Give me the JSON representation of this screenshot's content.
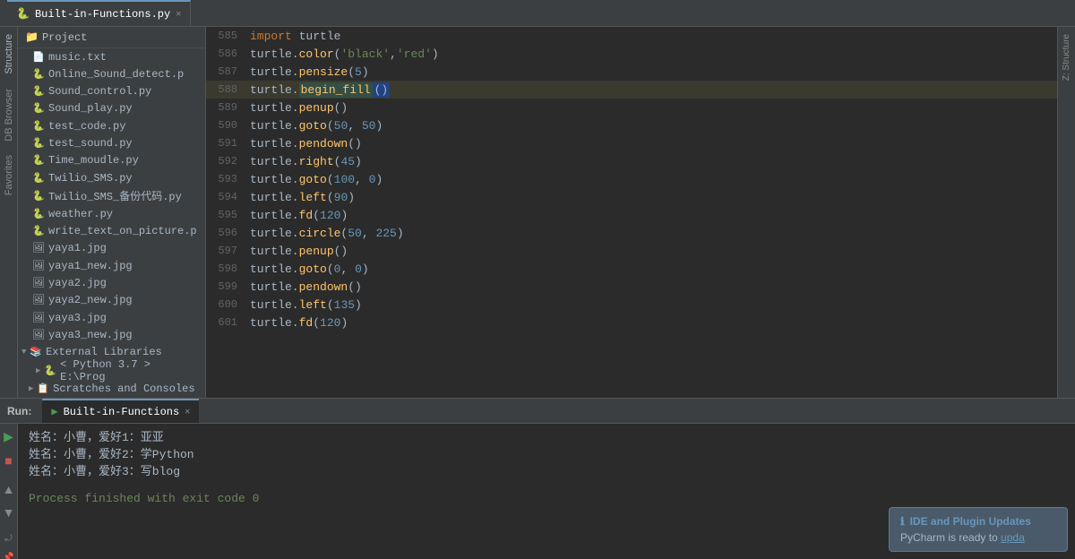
{
  "tabs": [
    {
      "label": "Built-in-Functions.py",
      "active": true,
      "icon": "🐍"
    }
  ],
  "sidebar": {
    "header": "Project",
    "items": [
      {
        "name": "music.txt",
        "icon": "📄",
        "indent": 1
      },
      {
        "name": "Online_Sound_detect.p",
        "icon": "🐍",
        "indent": 1
      },
      {
        "name": "Sound_control.py",
        "icon": "🐍",
        "indent": 1
      },
      {
        "name": "Sound_play.py",
        "icon": "🐍",
        "indent": 1
      },
      {
        "name": "test_code.py",
        "icon": "🐍",
        "indent": 1
      },
      {
        "name": "test_sound.py",
        "icon": "🐍",
        "indent": 1
      },
      {
        "name": "Time_moudle.py",
        "icon": "🐍",
        "indent": 1
      },
      {
        "name": "Twilio_SMS.py",
        "icon": "🐍",
        "indent": 1
      },
      {
        "name": "Twilio_SMS_备份代码.py",
        "icon": "🐍",
        "indent": 1
      },
      {
        "name": "weather.py",
        "icon": "🐍",
        "indent": 1
      },
      {
        "name": "write_text_on_picture.p",
        "icon": "🐍",
        "indent": 1
      },
      {
        "name": "yaya1.jpg",
        "icon": "🖼",
        "indent": 1
      },
      {
        "name": "yaya1_new.jpg",
        "icon": "🖼",
        "indent": 1
      },
      {
        "name": "yaya2.jpg",
        "icon": "🖼",
        "indent": 1
      },
      {
        "name": "yaya2_new.jpg",
        "icon": "🖼",
        "indent": 1
      },
      {
        "name": "yaya3.jpg",
        "icon": "🖼",
        "indent": 1
      },
      {
        "name": "yaya3_new.jpg",
        "icon": "🖼",
        "indent": 1
      }
    ],
    "sections": [
      {
        "name": "External Libraries",
        "expanded": true
      },
      {
        "name": "< Python 3.7 > E:\\Prog",
        "indent": 2,
        "icon": "🐍"
      },
      {
        "name": "Scratches and Consoles",
        "indent": 1,
        "icon": "📋"
      }
    ]
  },
  "code": {
    "lines": [
      {
        "num": 585,
        "content": "import turtle",
        "tokens": [
          {
            "t": "kw",
            "v": "import"
          },
          {
            "t": "fn",
            "v": " turtle"
          }
        ]
      },
      {
        "num": 586,
        "content": "turtle.color('black','red')",
        "tokens": [
          {
            "t": "obj",
            "v": "turtle"
          },
          {
            "t": "fn",
            "v": "."
          },
          {
            "t": "method",
            "v": "color"
          },
          {
            "t": "fn",
            "v": "("
          },
          {
            "t": "str",
            "v": "'black'"
          },
          {
            "t": "fn",
            "v": ","
          },
          {
            "t": "str",
            "v": "'red'"
          },
          {
            "t": "fn",
            "v": ")"
          }
        ]
      },
      {
        "num": 587,
        "content": "turtle.pensize(5)",
        "tokens": [
          {
            "t": "obj",
            "v": "turtle"
          },
          {
            "t": "fn",
            "v": "."
          },
          {
            "t": "method",
            "v": "pensize"
          },
          {
            "t": "fn",
            "v": "("
          },
          {
            "t": "num",
            "v": "5"
          },
          {
            "t": "fn",
            "v": ")"
          }
        ]
      },
      {
        "num": 588,
        "content": "turtle.begin_fill()",
        "highlighted": true,
        "tokens": [
          {
            "t": "obj",
            "v": "turtle"
          },
          {
            "t": "fn",
            "v": "."
          },
          {
            "t": "hl-word method",
            "v": "begin_fill"
          },
          {
            "t": "fn",
            "v": "()"
          }
        ]
      },
      {
        "num": 589,
        "content": "turtle.penup()",
        "tokens": [
          {
            "t": "obj",
            "v": "turtle"
          },
          {
            "t": "fn",
            "v": "."
          },
          {
            "t": "method",
            "v": "penup"
          },
          {
            "t": "fn",
            "v": "()"
          }
        ]
      },
      {
        "num": 590,
        "content": "turtle.goto(50, 50)",
        "tokens": [
          {
            "t": "obj",
            "v": "turtle"
          },
          {
            "t": "fn",
            "v": "."
          },
          {
            "t": "method",
            "v": "goto"
          },
          {
            "t": "fn",
            "v": "("
          },
          {
            "t": "num",
            "v": "50"
          },
          {
            "t": "fn",
            "v": ", "
          },
          {
            "t": "num",
            "v": "50"
          },
          {
            "t": "fn",
            "v": ")"
          }
        ]
      },
      {
        "num": 591,
        "content": "turtle.pendown()",
        "tokens": [
          {
            "t": "obj",
            "v": "turtle"
          },
          {
            "t": "fn",
            "v": "."
          },
          {
            "t": "method",
            "v": "pendown"
          },
          {
            "t": "fn",
            "v": "()"
          }
        ]
      },
      {
        "num": 592,
        "content": "turtle.right(45)",
        "tokens": [
          {
            "t": "obj",
            "v": "turtle"
          },
          {
            "t": "fn",
            "v": "."
          },
          {
            "t": "method",
            "v": "right"
          },
          {
            "t": "fn",
            "v": "("
          },
          {
            "t": "num",
            "v": "45"
          },
          {
            "t": "fn",
            "v": ")"
          }
        ]
      },
      {
        "num": 593,
        "content": "turtle.goto(100, 0)",
        "tokens": [
          {
            "t": "obj",
            "v": "turtle"
          },
          {
            "t": "fn",
            "v": "."
          },
          {
            "t": "method",
            "v": "goto"
          },
          {
            "t": "fn",
            "v": "("
          },
          {
            "t": "num",
            "v": "100"
          },
          {
            "t": "fn",
            "v": ", "
          },
          {
            "t": "num",
            "v": "0"
          },
          {
            "t": "fn",
            "v": ")"
          }
        ]
      },
      {
        "num": 594,
        "content": "turtle.left(90)",
        "tokens": [
          {
            "t": "obj",
            "v": "turtle"
          },
          {
            "t": "fn",
            "v": "."
          },
          {
            "t": "method",
            "v": "left"
          },
          {
            "t": "fn",
            "v": "("
          },
          {
            "t": "num",
            "v": "90"
          },
          {
            "t": "fn",
            "v": ")"
          }
        ]
      },
      {
        "num": 595,
        "content": "turtle.fd(120)",
        "tokens": [
          {
            "t": "obj",
            "v": "turtle"
          },
          {
            "t": "fn",
            "v": "."
          },
          {
            "t": "method",
            "v": "fd"
          },
          {
            "t": "fn",
            "v": "("
          },
          {
            "t": "num",
            "v": "120"
          },
          {
            "t": "fn",
            "v": ")"
          }
        ]
      },
      {
        "num": 596,
        "content": "turtle.circle(50, 225)",
        "tokens": [
          {
            "t": "obj",
            "v": "turtle"
          },
          {
            "t": "fn",
            "v": "."
          },
          {
            "t": "method",
            "v": "circle"
          },
          {
            "t": "fn",
            "v": "("
          },
          {
            "t": "num",
            "v": "50"
          },
          {
            "t": "fn",
            "v": ", "
          },
          {
            "t": "num",
            "v": "225"
          },
          {
            "t": "fn",
            "v": ")"
          }
        ]
      },
      {
        "num": 597,
        "content": "turtle.penup()",
        "tokens": [
          {
            "t": "obj",
            "v": "turtle"
          },
          {
            "t": "fn",
            "v": "."
          },
          {
            "t": "method",
            "v": "penup"
          },
          {
            "t": "fn",
            "v": "()"
          }
        ]
      },
      {
        "num": 598,
        "content": "turtle.goto(0, 0)",
        "tokens": [
          {
            "t": "obj",
            "v": "turtle"
          },
          {
            "t": "fn",
            "v": "."
          },
          {
            "t": "method",
            "v": "goto"
          },
          {
            "t": "fn",
            "v": "("
          },
          {
            "t": "num",
            "v": "0"
          },
          {
            "t": "fn",
            "v": ", "
          },
          {
            "t": "num",
            "v": "0"
          },
          {
            "t": "fn",
            "v": ")"
          }
        ]
      },
      {
        "num": 599,
        "content": "turtle.pendown()",
        "tokens": [
          {
            "t": "obj",
            "v": "turtle"
          },
          {
            "t": "fn",
            "v": "."
          },
          {
            "t": "method",
            "v": "pendown"
          },
          {
            "t": "fn",
            "v": "()"
          }
        ]
      },
      {
        "num": 600,
        "content": "turtle.left(135)",
        "tokens": [
          {
            "t": "obj",
            "v": "turtle"
          },
          {
            "t": "fn",
            "v": "."
          },
          {
            "t": "method",
            "v": "left"
          },
          {
            "t": "fn",
            "v": "("
          },
          {
            "t": "num",
            "v": "135"
          },
          {
            "t": "fn",
            "v": ")"
          }
        ]
      },
      {
        "num": 601,
        "content": "turtle.fd(120)",
        "tokens": [
          {
            "t": "obj",
            "v": "turtle"
          },
          {
            "t": "fn",
            "v": "."
          },
          {
            "t": "method",
            "v": "fd"
          },
          {
            "t": "fn",
            "v": "("
          },
          {
            "t": "num",
            "v": "120"
          },
          {
            "t": "fn",
            "v": ")"
          }
        ]
      }
    ]
  },
  "run": {
    "label": "Run:",
    "tab_label": "Built-in-Functions",
    "output": [
      "姓名：小曹，爱好1：亚亚",
      "姓名：小曹，爱好2：学Python",
      "姓名：小曹，爱好3：写blog",
      "",
      "Process finished with exit code 0"
    ]
  },
  "notification": {
    "title": "IDE and Plugin Updates",
    "body": "PyCharm is ready to ",
    "link": "upda"
  },
  "left_strip_labels": [
    "Structure",
    "DB Browser",
    "Favorites"
  ],
  "right_strip_labels": [
    "Z: Structure"
  ]
}
